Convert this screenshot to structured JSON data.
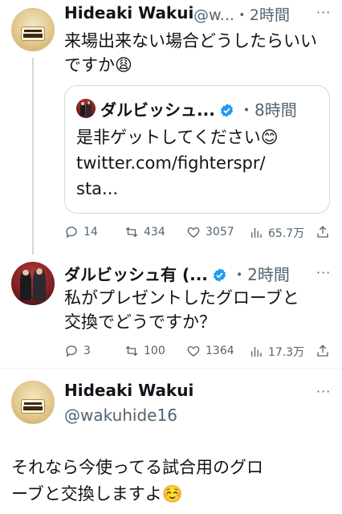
{
  "tweet1": {
    "name": "Hideaki Wakui",
    "handle_time": "@w...・2時間",
    "more": "···",
    "text_line1": "来場出来ない場合どうしたらいい",
    "text_line2": "ですか",
    "emoji": "😩",
    "quote": {
      "name": "ダルビッシュ...",
      "time": "・8時間",
      "text_line1": "是非ゲットしてください",
      "emoji": "😊",
      "link_line1": "twitter.com/fighterspr/",
      "link_line2": "sta..."
    },
    "actions": {
      "replies": "14",
      "retweets": "434",
      "likes": "3057",
      "views": "65.7万"
    }
  },
  "tweet2": {
    "name": "ダルビッシュ有 (...",
    "time": "・2時間",
    "more": "···",
    "text_line1": "私がプレゼントしたグローブと",
    "text_line2": "交換でどうですか？",
    "actions": {
      "replies": "3",
      "retweets": "100",
      "likes": "1364",
      "views": "17.3万"
    }
  },
  "tweet3": {
    "name": "Hideaki Wakui",
    "handle": "@wakuhide16",
    "more": "···",
    "text_line1": "それなら今使ってる試合用のグロ",
    "text_line2": "ーブと交換しますよ",
    "emoji": "☺️"
  },
  "colors": {
    "text": "#0f1419",
    "secondary": "#536471",
    "border": "#cfd9de",
    "verified": "#1d9bf0"
  },
  "icons": [
    "reply-icon",
    "retweet-icon",
    "like-icon",
    "views-icon",
    "share-icon",
    "verified-badge-icon",
    "more-icon"
  ]
}
